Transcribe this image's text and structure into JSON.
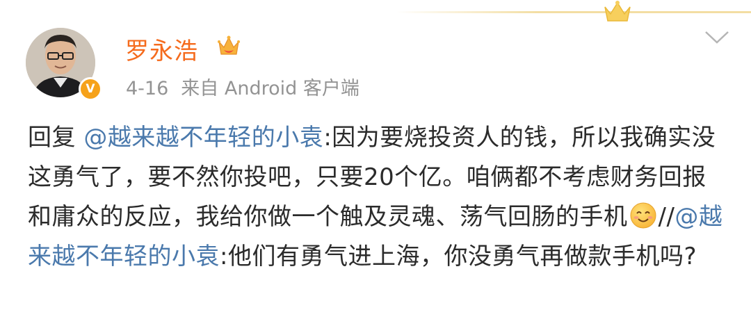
{
  "post": {
    "author": {
      "name": "罗永浩",
      "verified_badge_letter": "V",
      "name_color": "#f56b1d"
    },
    "timestamp": "4-16",
    "source": "来自 Android 客户端",
    "content": {
      "reply_prefix": "回复",
      "mention1": "@越来越不年轻的小袁",
      "text1": ":因为要烧投资人的钱，所以我确实没这勇气了，要不然你投吧，只要20个亿。咱俩都不考虑财务回报和庸众的反应，我给你做一个触及灵魂、荡气回肠的手机",
      "emoji": "smile-emoji",
      "separator": "//",
      "mention2": "@越来越不年轻的小袁",
      "text2": ":他们有勇气进上海，你没勇气再做款手机吗?"
    }
  },
  "colors": {
    "mention": "#4a79ac",
    "meta": "#939393",
    "badge": "#f6a21a",
    "gold": "#f3dea3"
  }
}
